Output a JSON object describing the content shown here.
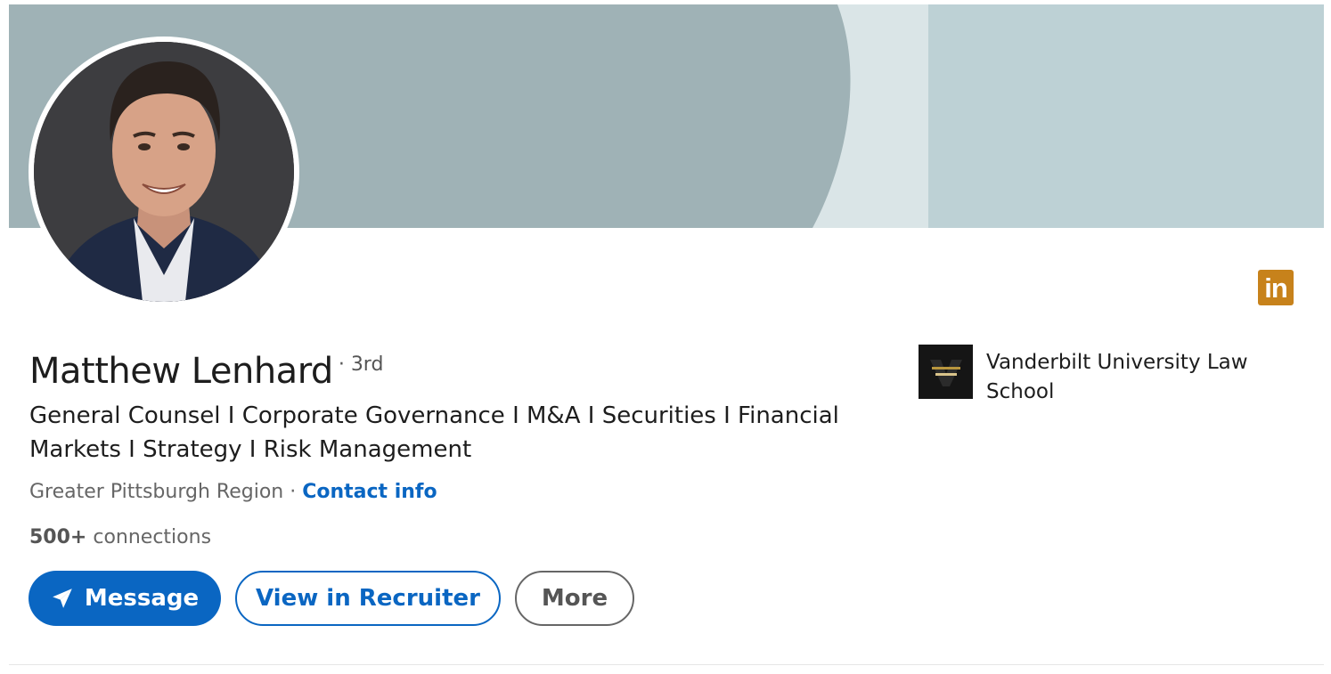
{
  "profile": {
    "name": "Matthew Lenhard",
    "degree": "· 3rd",
    "headline": "General Counsel I Corporate Governance I M&A I Securities I Financial Markets I Strategy I Risk Management",
    "location": "Greater Pittsburgh Region",
    "location_separator": " · ",
    "contact_label": "Contact info",
    "connections_count": "500+",
    "connections_label": " connections"
  },
  "education": {
    "school_name": "Vanderbilt University Law School",
    "logo_icon": "vanderbilt-law-logo"
  },
  "actions": {
    "message_label": "Message",
    "message_icon": "send-icon",
    "recruiter_label": "View in Recruiter",
    "more_label": "More"
  },
  "badge": {
    "text": "in",
    "icon": "linkedin-icon",
    "color": "#c7821b"
  },
  "colors": {
    "brand": "#0a66c2",
    "banner_dark": "#9fb2b6",
    "banner_light": "#bdd1d5",
    "banner_stripe": "#dae5e7"
  }
}
